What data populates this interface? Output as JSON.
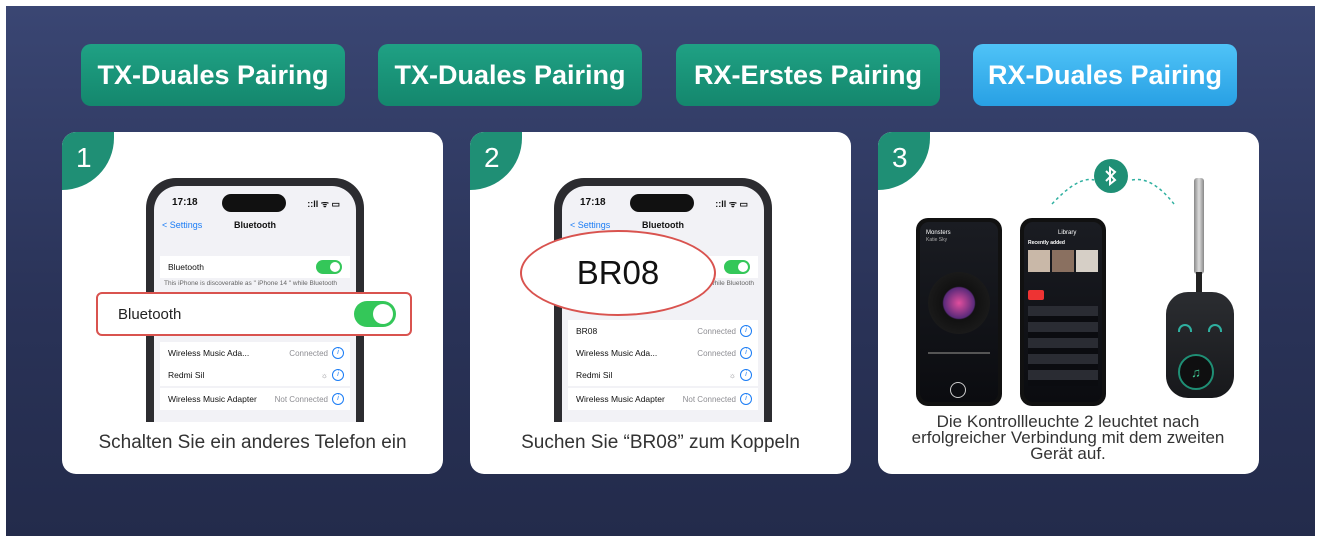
{
  "tabs": [
    {
      "label": "TX-Duales Pairing"
    },
    {
      "label": "TX-Duales Pairing"
    },
    {
      "label": "RX-Erstes Pairing"
    },
    {
      "label": "RX-Duales Pairing",
      "active": true
    }
  ],
  "colors": {
    "tab": "#17957a",
    "tab_active": "#38b3ee",
    "badge": "#1f8f75",
    "background": "#2c3560",
    "toggle": "#34c759",
    "callout": "#d9534f"
  },
  "steps": [
    {
      "number": "1",
      "caption": "Schalten Sie ein anderes Telefon ein",
      "phone": {
        "time": "17:18",
        "status": "::ll ᯤ ▭",
        "back": "< Settings",
        "title": "Bluetooth",
        "bluetooth_label": "Bluetooth",
        "discoverable": "This iPhone is discoverable as \" iPhone 14 \" while Bluetooth",
        "callout": "Bluetooth",
        "devices": [
          {
            "name": "Wireless Music Ada...",
            "status": "Connected"
          },
          {
            "name": "Redmi Sil",
            "status": "☼"
          },
          {
            "name": "Wireless Music Adapter",
            "status": "Not Connected"
          }
        ]
      }
    },
    {
      "number": "2",
      "caption": "Suchen Sie “BR08” zum Koppeln",
      "phone": {
        "time": "17:18",
        "status": "::ll ᯤ ▭",
        "back": "< Settings",
        "title": "Bluetooth",
        "discoverable_tail": "while Bluetooth",
        "callout": "BR08",
        "devices": [
          {
            "name": "BR08",
            "status": "Connected"
          },
          {
            "name": "Wireless Music Ada...",
            "status": "Connected"
          },
          {
            "name": "Redmi Sil",
            "status": "☼"
          },
          {
            "name": "Wireless Music Adapter",
            "status": "Not Connected"
          }
        ]
      }
    },
    {
      "number": "3",
      "caption": "Die Kontrollleuchte 2 leuchtet nach erfolgreicher Verbindung mit dem zweiten Gerät auf.",
      "left_phone": {
        "song": "Monsters",
        "artist": "Katie Sky"
      },
      "right_phone": {
        "title": "Library",
        "section": "Recently added"
      },
      "icons": [
        "bluetooth-icon",
        "music-icon"
      ]
    }
  ]
}
